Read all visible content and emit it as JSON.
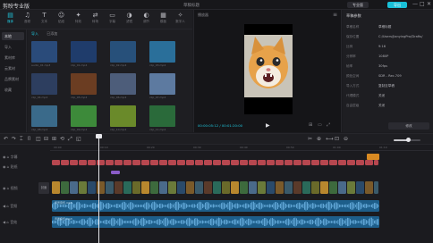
{
  "app": {
    "title": "剪映专业版",
    "project_title": "草稿标题",
    "pro_label": "专业版",
    "export_label": "导出"
  },
  "window_controls": [
    "—",
    "□",
    "✕"
  ],
  "asset_tools": [
    {
      "icon": "▤",
      "label": "媒体"
    },
    {
      "icon": "♫",
      "label": "音频"
    },
    {
      "icon": "T",
      "label": "文本"
    },
    {
      "icon": "☺",
      "label": "贴纸"
    },
    {
      "icon": "✦",
      "label": "特效"
    },
    {
      "icon": "⇄",
      "label": "转场"
    },
    {
      "icon": "▭",
      "label": "字幕"
    },
    {
      "icon": "◑",
      "label": "滤镜"
    },
    {
      "icon": "◐",
      "label": "调节"
    },
    {
      "icon": "▦",
      "label": "模板"
    },
    {
      "icon": "✧",
      "label": "数字人"
    }
  ],
  "sidebar": {
    "items": [
      {
        "label": "本地"
      },
      {
        "label": "导入"
      },
      {
        "label": "素材库"
      },
      {
        "label": "云素材"
      },
      {
        "label": "品牌素材"
      },
      {
        "label": "收藏"
      }
    ]
  },
  "library": {
    "tabs": [
      "导入",
      "已添加"
    ],
    "thumbs": [
      {
        "label": "audio_01.mp3",
        "color": "#2a4b7a"
      },
      {
        "label": "clip_01.mp4",
        "color": "#1f3c6b"
      },
      {
        "label": "clip_02.mp4",
        "color": "#27507a"
      },
      {
        "label": "clip_03.mp4",
        "color": "#2a6f9a"
      },
      {
        "label": "clip_04.mp4",
        "color": "#2d3e5f"
      },
      {
        "label": "clip_05.mp4",
        "color": "#6b3d22"
      },
      {
        "label": "clip_06.mp4",
        "color": "#4d5d7a"
      },
      {
        "label": "clip_07.mp4",
        "color": "#5d7aa0"
      },
      {
        "label": "clip_08.mp4",
        "color": "#3a6a8a"
      },
      {
        "label": "clip_09.mp4",
        "color": "#3d8a3a"
      },
      {
        "label": "clip_10.mp4",
        "color": "#6a8a2a"
      },
      {
        "label": "clip_11.mp4",
        "color": "#2a6a3a"
      },
      {
        "label": "clip_12.mp4",
        "color": "#6a5a2a"
      }
    ]
  },
  "player": {
    "title": "播放器",
    "time": "00:00:05:12 / 00:01:20:00",
    "play_icon": "▶"
  },
  "inspector": {
    "title": "草稿参数",
    "rows": [
      {
        "key": "草稿名称",
        "value": "草稿标题"
      },
      {
        "key": "保存位置",
        "value": "C:/Users/JianyingPro/Drafts/"
      },
      {
        "key": "比例",
        "value": "9:16"
      },
      {
        "key": "分辨率",
        "value": "1080P"
      },
      {
        "key": "帧率",
        "value": "30fps"
      },
      {
        "key": "颜色空间",
        "value": "SDR - Rec.709"
      },
      {
        "key": "导入方式",
        "value": "复制至草稿"
      },
      {
        "key": "代理模式",
        "value": "关闭"
      },
      {
        "key": "自由层级",
        "value": "关闭"
      }
    ],
    "modify_label": "修改"
  },
  "timeline": {
    "tools": [
      "↶",
      "↷",
      "⌶",
      "⌷",
      "◫",
      "⊟",
      "⊞",
      "⟲",
      "⤢",
      "◱"
    ],
    "right_tools": [
      "✂",
      "⊕",
      "⟷",
      "⊡",
      "⊖"
    ],
    "ruler_ticks": [
      "00:00",
      "00:10",
      "00:20",
      "00:30",
      "00:40",
      "00:50",
      "01:00",
      "01:10"
    ],
    "tracks": [
      "字幕",
      "贴纸",
      "视频",
      "音频",
      "音效"
    ],
    "cover_label": "封面",
    "text_clip_label": "字幕文本内容示例",
    "audio_label": "背景音乐.mp3",
    "zoom_level": 0.55
  }
}
